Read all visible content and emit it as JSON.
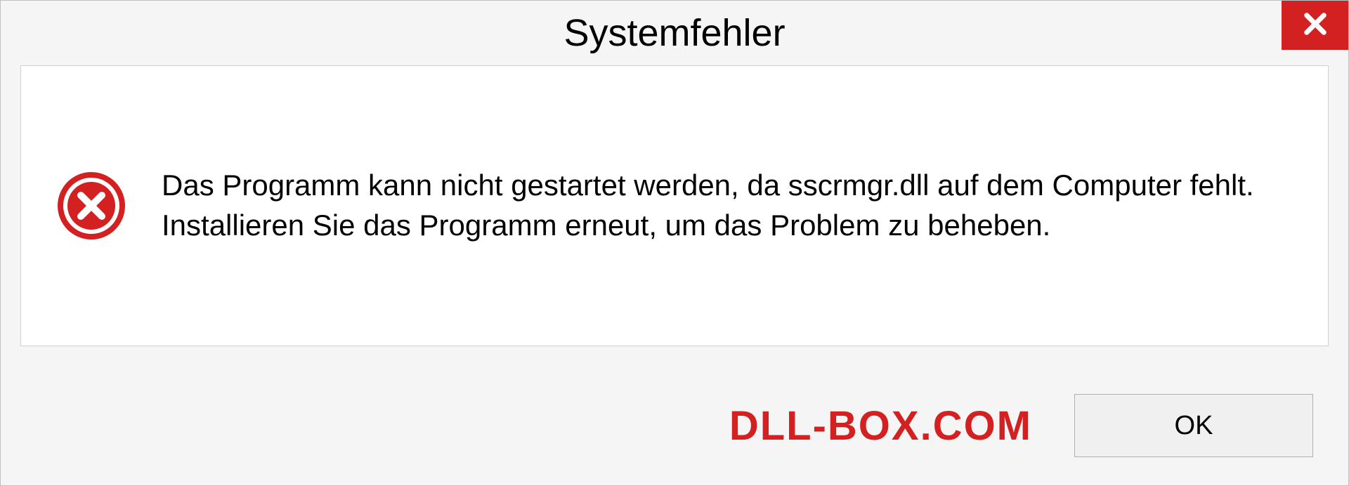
{
  "dialog": {
    "title": "Systemfehler",
    "message": "Das Programm kann nicht gestartet werden, da sscrmgr.dll auf dem Computer fehlt. Installieren Sie das Programm erneut, um das Problem zu beheben.",
    "ok_label": "OK"
  },
  "watermark": "DLL-BOX.COM",
  "colors": {
    "error_red": "#d32020",
    "close_red": "#d32020"
  }
}
